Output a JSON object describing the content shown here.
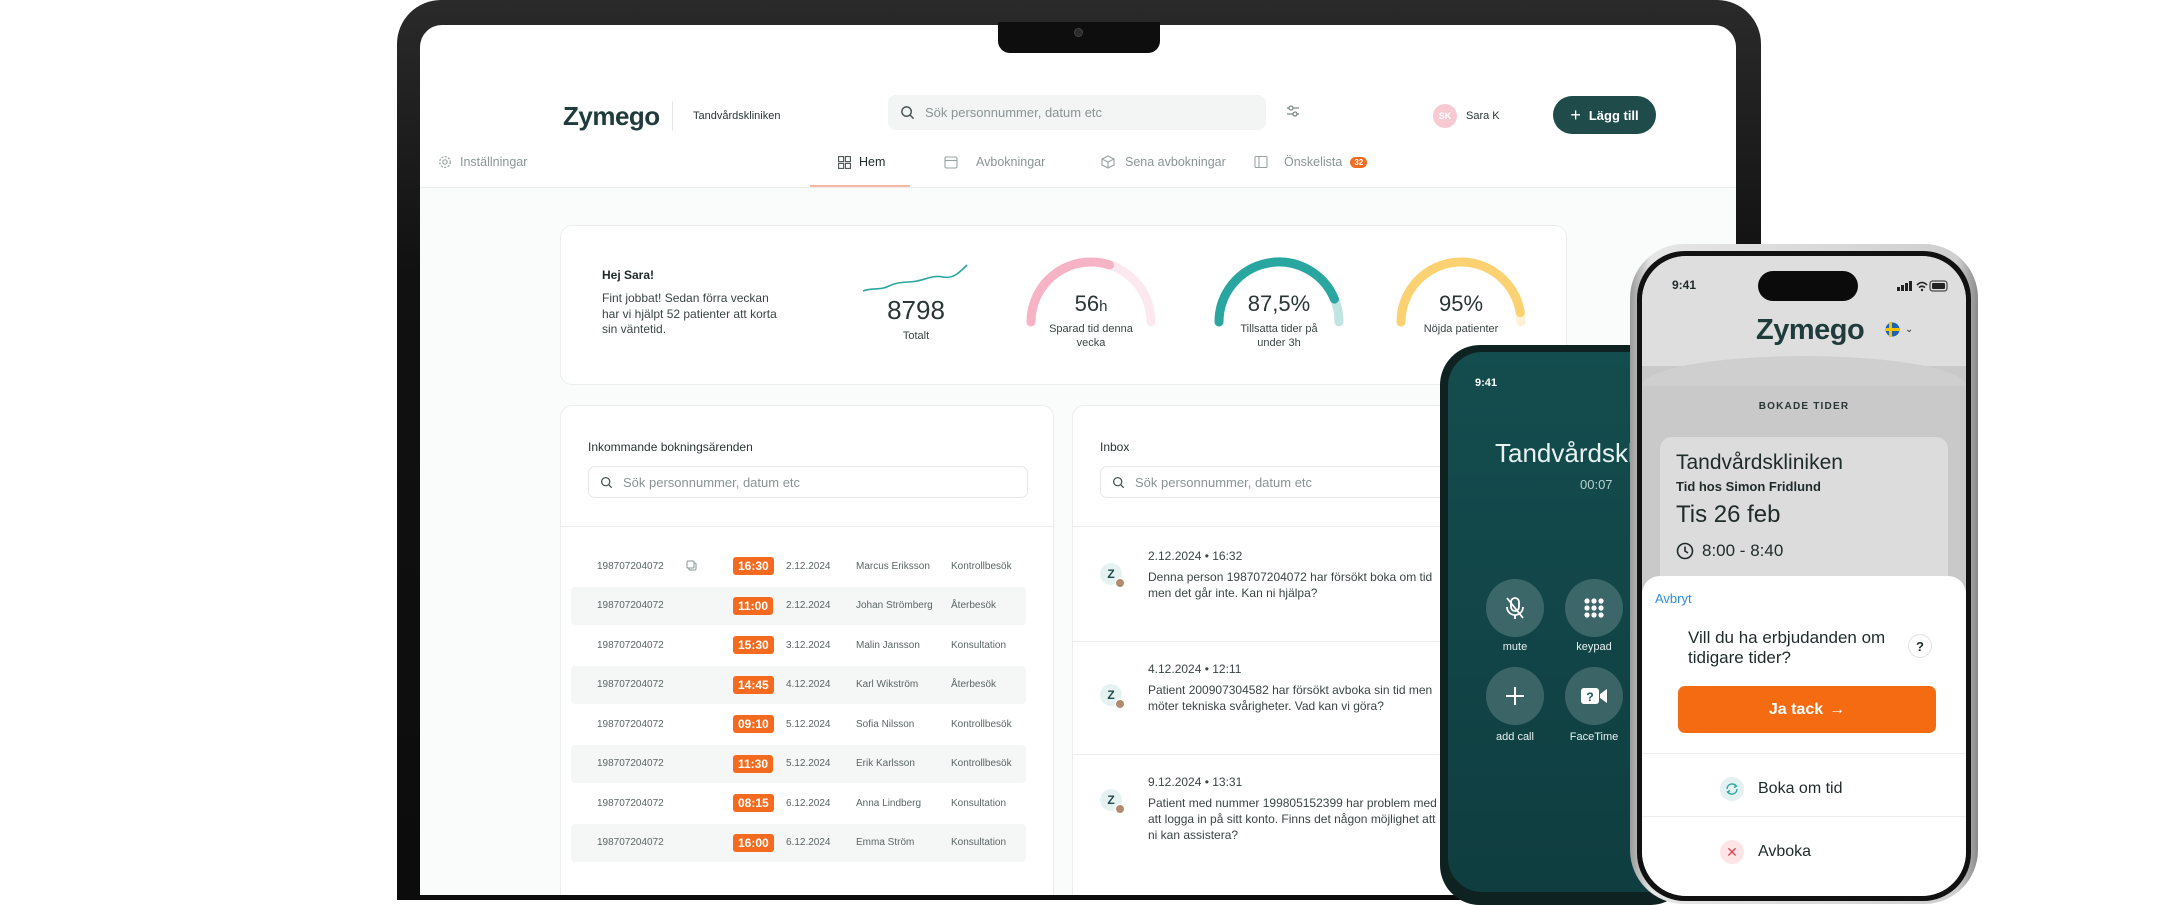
{
  "laptop": {
    "brand": "Zymego",
    "clinic": "Tandvårdskliniken",
    "search_placeholder": "Sök personnummer, datum etc",
    "user": {
      "initials": "SK",
      "name": "Sara K"
    },
    "add_button": "Lägg till",
    "settings": "Inställningar",
    "nav": {
      "home": "Hem",
      "cancellations": "Avbokningar",
      "late_cancellations": "Sena avbokningar",
      "wishlist": "Önskelista",
      "wishlist_count": "32"
    },
    "summary": {
      "greeting": "Hej Sara!",
      "message": "Fint jobbat! Sedan förra veckan har vi hjälpt 52 patienter att korta sin väntetid.",
      "total_value": "8798",
      "total_label": "Totalt",
      "saved_value": "56",
      "saved_unit": "h",
      "saved_label": "Sparad tid denna vecka",
      "saved_fraction": 0.6,
      "filled_value": "87,5%",
      "filled_label": "Tillsatta tider på under 3h",
      "filled_fraction": 0.875,
      "satisfied_value": "95%",
      "satisfied_label": "Nöjda patienter",
      "satisfied_fraction": 0.95
    },
    "incoming": {
      "title": "Inkommande bokningsärenden",
      "search_placeholder": "Sök personnummer, datum etc",
      "rows": [
        {
          "pn": "198707204072",
          "time": "16:30",
          "date": "2.12.2024",
          "name": "Marcus Eriksson",
          "type": "Kontrollbesök"
        },
        {
          "pn": "198707204072",
          "time": "11:00",
          "date": "2.12.2024",
          "name": "Johan Strömberg",
          "type": "Återbesök"
        },
        {
          "pn": "198707204072",
          "time": "15:30",
          "date": "3.12.2024",
          "name": "Malin Jansson",
          "type": "Konsultation"
        },
        {
          "pn": "198707204072",
          "time": "14:45",
          "date": "4.12.2024",
          "name": "Karl Wikström",
          "type": "Återbesök"
        },
        {
          "pn": "198707204072",
          "time": "09:10",
          "date": "5.12.2024",
          "name": "Sofia Nilsson",
          "type": "Kontrollbesök"
        },
        {
          "pn": "198707204072",
          "time": "11:30",
          "date": "5.12.2024",
          "name": "Erik Karlsson",
          "type": "Kontrollbesök"
        },
        {
          "pn": "198707204072",
          "time": "08:15",
          "date": "6.12.2024",
          "name": "Anna Lindberg",
          "type": "Konsultation"
        },
        {
          "pn": "198707204072",
          "time": "16:00",
          "date": "6.12.2024",
          "name": "Emma Ström",
          "type": "Konsultation"
        }
      ]
    },
    "inbox": {
      "title": "Inbox",
      "search_placeholder": "Sök personnummer, datum etc",
      "messages": [
        {
          "avatar": "Z",
          "timestamp": "2.12.2024 • 16:32",
          "text": "Denna person 198707204072 har försökt boka om tid men det går inte. Kan ni hjälpa?"
        },
        {
          "avatar": "Z",
          "timestamp": "4.12.2024 • 12:11",
          "text": "Patient 200907304582 har försökt avboka sin tid men möter tekniska svårigheter. Vad kan vi göra?"
        },
        {
          "avatar": "Z",
          "timestamp": "9.12.2024 • 13:31",
          "text": "Patient med nummer 199805152399 har problem med att logga in på sitt konto. Finns det någon möjlighet att ni kan assistera?"
        }
      ]
    }
  },
  "call_phone": {
    "status_time": "9:41",
    "caller": "Tandvårdsklinik",
    "duration": "00:07",
    "buttons": {
      "mute": "mute",
      "keypad": "keypad",
      "add_call": "add call",
      "facetime": "FaceTime"
    }
  },
  "app_phone": {
    "status_time": "9:41",
    "brand": "Zymego",
    "section_title": "BOKADE TIDER",
    "clinic": "Tandvårdskliniken",
    "appointment_with": "Tid hos Simon Fridlund",
    "date": "Tis 26 feb",
    "time_range": "8:00 - 8:40",
    "cancel_link": "Avbryt",
    "question": "Vill du ha erbjudanden om tidigare tider?",
    "help": "?",
    "cta": "Ja tack",
    "reschedule": "Boka om tid",
    "cancel_booking": "Avboka"
  },
  "colors": {
    "brand_dark": "#1f4b4b",
    "accent_orange": "#f46b1f",
    "teal": "#2aa6a0",
    "pink": "#f6b3c6",
    "yellow": "#fcd171"
  }
}
